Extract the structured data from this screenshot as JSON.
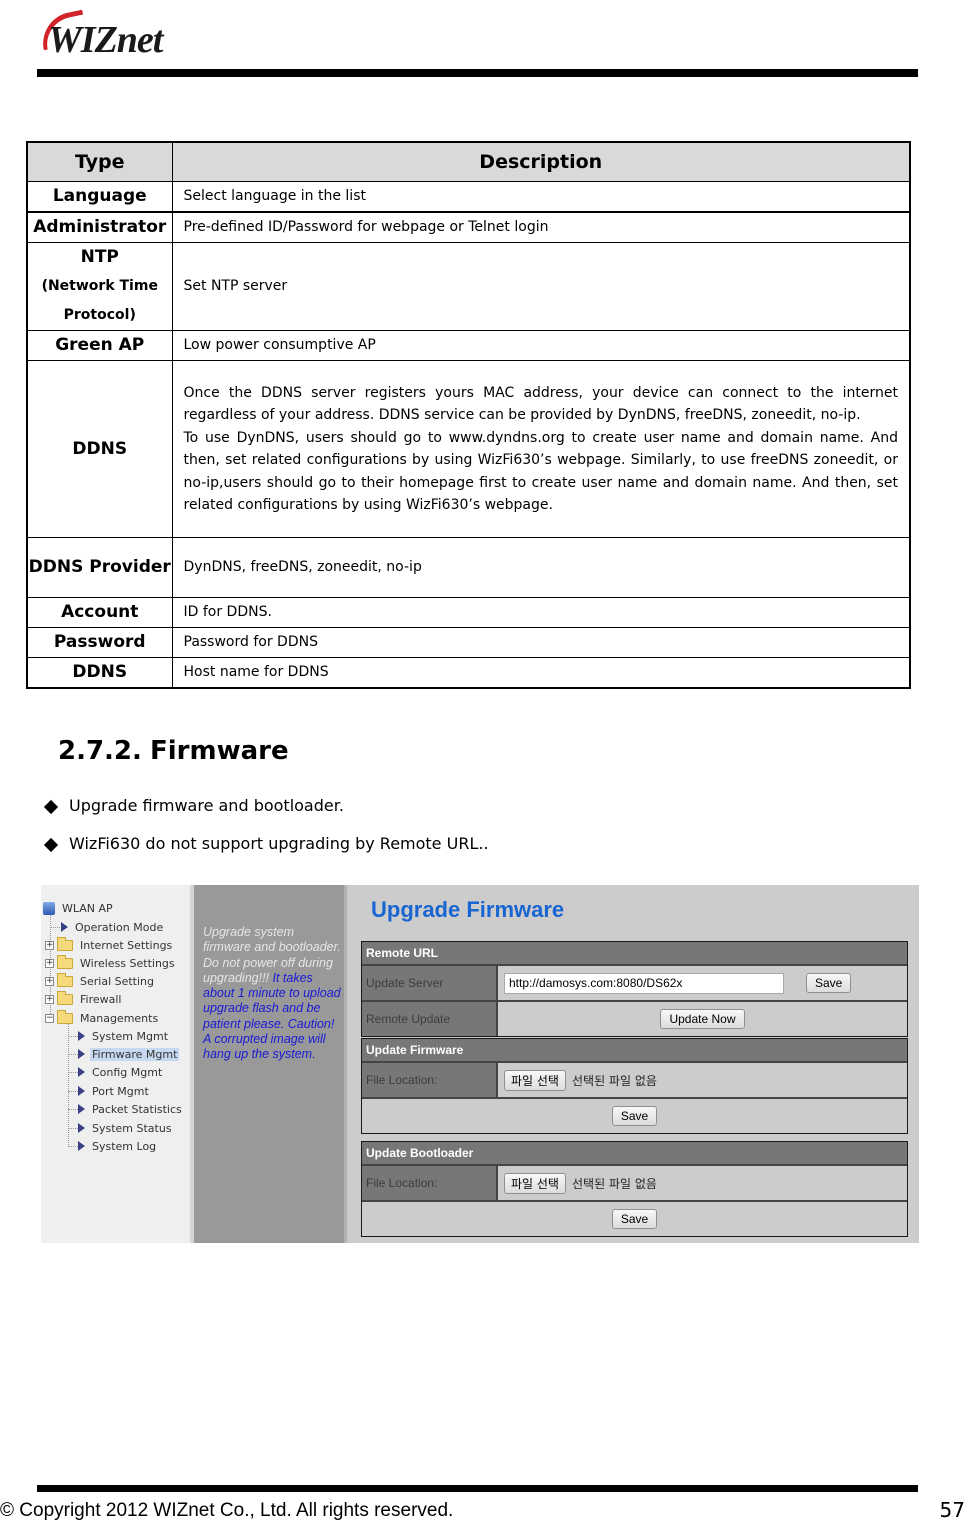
{
  "header": {
    "logo_text": "WIZnet"
  },
  "table": {
    "headers": [
      "Type",
      "Description"
    ],
    "rows": [
      {
        "type": "Language",
        "type_sub": "",
        "description": [
          "Select language in the list"
        ]
      },
      {
        "type": "Administrator",
        "type_sub": "",
        "description": [
          "Pre-defined ID/Password for webpage or Telnet login"
        ]
      },
      {
        "type": "NTP",
        "type_sub": "(Network Time Protocol)",
        "description": [
          "Set NTP server"
        ]
      },
      {
        "type": "Green AP",
        "type_sub": "",
        "description": [
          "Low power consumptive AP"
        ]
      },
      {
        "type": "DDNS",
        "type_sub": "",
        "description": [
          "Once the DDNS server registers yours MAC address, your device can connect to the internet regardless of your address. DDNS service can be provided by DynDNS, freeDNS, zoneedit, no-ip.",
          "To use DynDNS, users should go to www.dyndns.org to create user name and domain name. And then, set related configurations by using WizFi630’s webpage. Similarly, to use freeDNS zoneedit, or no-ip,users should go to their homepage first to create user name and domain name. And then, set related configurations by using WizFi630’s webpage."
        ]
      },
      {
        "type": "DDNS Provider",
        "type_sub": "",
        "description": [
          "DynDNS, freeDNS, zoneedit, no-ip"
        ]
      },
      {
        "type": "Account",
        "type_sub": "",
        "description": [
          "ID for DDNS."
        ]
      },
      {
        "type": "Password",
        "type_sub": "",
        "description": [
          "Password for DDNS"
        ]
      },
      {
        "type": "DDNS",
        "type_sub": "",
        "description": [
          "Host name for DDNS"
        ]
      }
    ]
  },
  "section": {
    "number": "2.7.2.",
    "title": "Firmware",
    "bullets": [
      "Upgrade firmware and bootloader.",
      "WizFi630 do not support upgrading by Remote URL.."
    ]
  },
  "screenshot": {
    "nav": {
      "root": "WLAN AP",
      "items": [
        {
          "label": "Operation Mode",
          "kind": "page"
        },
        {
          "label": "Internet Settings",
          "kind": "folder"
        },
        {
          "label": "Wireless Settings",
          "kind": "folder"
        },
        {
          "label": "Serial Setting",
          "kind": "folder"
        },
        {
          "label": "Firewall",
          "kind": "folder"
        },
        {
          "label": "Managements",
          "kind": "folder-open"
        }
      ],
      "sub_items": [
        {
          "label": "System Mgmt",
          "selected": false
        },
        {
          "label": "Firmware Mgmt",
          "selected": true
        },
        {
          "label": "Config Mgmt",
          "selected": false
        },
        {
          "label": "Port Mgmt",
          "selected": false
        },
        {
          "label": "Packet Statistics",
          "selected": false
        },
        {
          "label": "System Status",
          "selected": false
        },
        {
          "label": "System Log",
          "selected": false
        }
      ]
    },
    "help": {
      "warning": "Upgrade system firmware and bootloader. Do not power off during upgrading!!!",
      "note": "It takes about 1 minute to upload   upgrade flash and be patient please. Caution! A corrupted image will hang up the system."
    },
    "page_title": "Upgrade Firmware",
    "remote_url": {
      "heading": "Remote URL",
      "update_server_label": "Update Server",
      "update_server_value": "http://damosys.com:8080/DS62x",
      "save_label": "Save",
      "remote_update_label": "Remote Update",
      "update_now_label": "Update Now"
    },
    "update_firmware": {
      "heading": "Update Firmware",
      "file_location_label": "File Location:",
      "choose_file_label": "파일 선택",
      "no_file_text": "선택된 파일 없음",
      "save_label": "Save"
    },
    "update_bootloader": {
      "heading": "Update Bootloader",
      "file_location_label": "File Location:",
      "choose_file_label": "파일 선택",
      "no_file_text": "선택된 파일 없음",
      "save_label": "Save"
    },
    "colors": {
      "title_blue": "#1966d2",
      "note_blue": "#1a1ad6",
      "section_header_grey": "#777777"
    }
  },
  "footer": {
    "copyright": "© Copyright 2012 WIZnet Co., Ltd. All rights reserved.",
    "page_number": "57"
  }
}
